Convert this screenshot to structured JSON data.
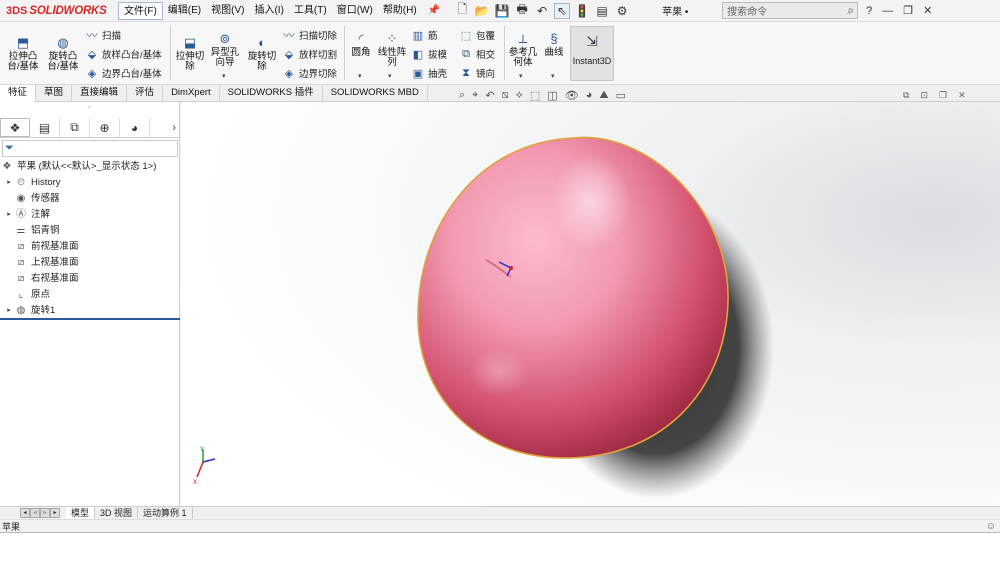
{
  "app": {
    "logo_prefix": "3DS",
    "logo_text": "SOLIDWORKS",
    "doc_title": "苹果 •"
  },
  "menu": [
    "文件(F)",
    "编辑(E)",
    "视图(V)",
    "插入(I)",
    "工具(T)",
    "窗口(W)",
    "帮助(H)"
  ],
  "search": {
    "placeholder": "搜索命令"
  },
  "ribbon": {
    "extrude_boss": "拉伸凸\n台/基体",
    "revolve_boss": "旋转凸\n台/基体",
    "sweep": "扫描",
    "loft_boss": "放样凸台/基体",
    "boundary_boss": "边界凸台/基体",
    "extrude_cut": "拉伸切\n除",
    "hole_wizard": "异型孔\n向导",
    "revolve_cut": "旋转切\n除",
    "sweep_cut": "扫描切除",
    "loft_cut": "放样切割",
    "boundary_cut": "边界切除",
    "fillet": "圆角",
    "linear_pattern": "线性阵\n列",
    "rib": "筋",
    "draft": "拔模",
    "shell": "抽壳",
    "wrap": "包覆",
    "intersect": "相交",
    "mirror": "镜向",
    "ref_geometry": "参考几\n何体",
    "curves": "曲线",
    "instant3d": "Instant3D"
  },
  "tabs": [
    "特征",
    "草图",
    "直接编辑",
    "评估",
    "DimXpert",
    "SOLIDWORKS 插件",
    "SOLIDWORKS MBD"
  ],
  "tree": {
    "root": "苹果  (默认<<默认>_显示状态 1>)",
    "items": [
      "History",
      "传感器",
      "注解",
      "铝青铜",
      "前视基准面",
      "上视基准面",
      "右视基准面",
      "原点",
      "旋转1"
    ]
  },
  "bottom_tabs": [
    "模型",
    "3D 视图",
    "运动算例 1"
  ],
  "status": {
    "text": "苹果"
  },
  "colors": {
    "apple_light": "#f7a9bd",
    "apple_dark": "#9d1f3a",
    "edge": "#e2a23a",
    "accent": "#d62828"
  }
}
